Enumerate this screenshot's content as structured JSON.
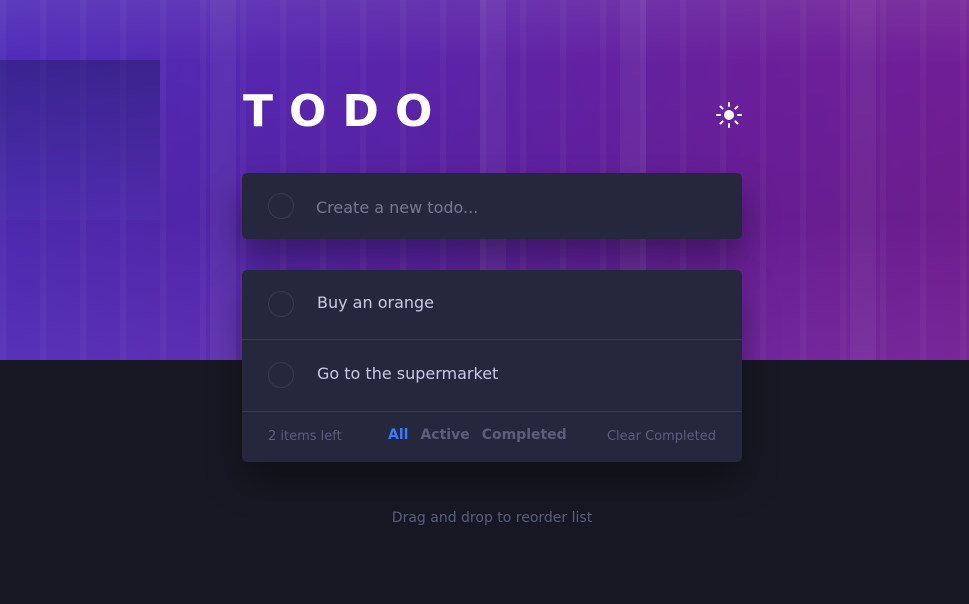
{
  "header": {
    "title": "TODO",
    "theme_icon": "sun-icon"
  },
  "new_todo": {
    "placeholder": "Create a new todo..."
  },
  "todos": [
    {
      "text": "Buy an orange",
      "completed": false
    },
    {
      "text": "Go to the supermarket",
      "completed": false
    }
  ],
  "footer": {
    "items_left": "2 items left",
    "filters": [
      {
        "label": "All",
        "active": true
      },
      {
        "label": "Active",
        "active": false
      },
      {
        "label": "Completed",
        "active": false
      }
    ],
    "clear_label": "Clear Completed"
  },
  "hint": "Drag and drop to reorder list",
  "colors": {
    "background": "#171823",
    "card": "#25273d",
    "text": "#c8cbe7",
    "muted": "#5b5e7e",
    "accent": "#3a7cfd",
    "hero_gradient_start": "#4e2bb8",
    "hero_gradient_end": "#731e94"
  }
}
